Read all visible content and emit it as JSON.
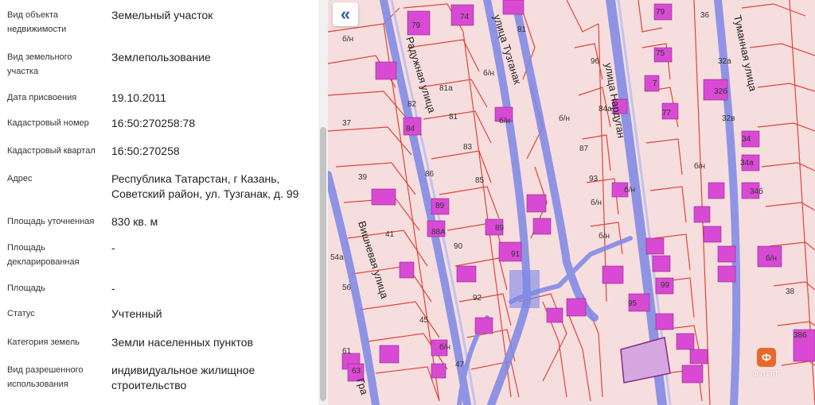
{
  "info_panel": {
    "rows": [
      {
        "label": "Вид объекта недвижимости",
        "value": "Земельный участок"
      },
      {
        "label": "Вид земельного участка",
        "value": "Землепользование"
      },
      {
        "label": "Дата присвоения",
        "value": "19.10.2011"
      },
      {
        "label": "Кадастровый номер",
        "value": "16:50:270258:78"
      },
      {
        "label": "Кадастровый квартал",
        "value": "16:50:270258"
      },
      {
        "label": "Адрес",
        "value": "Республика Татарстан, г Казань, Советский район, ул. Тузганак, д. 99"
      },
      {
        "label": "Площадь уточненная",
        "value": "830 кв. м"
      },
      {
        "label": "Площадь декларированная",
        "value": "-"
      },
      {
        "label": "Площадь",
        "value": "-"
      },
      {
        "label": "Статус",
        "value": "Учтенный"
      },
      {
        "label": "Категория земель",
        "value": "Земли населенных пунктов"
      },
      {
        "label": "Вид разрешенного использования",
        "value": "индивидуальное жилищное строительство"
      }
    ]
  },
  "map": {
    "collapse_icon": "double-chevron-left-icon",
    "collapse_symbol": "«",
    "streets": {
      "raduzhnaya": "Радужная улица",
      "tuzganak": "улица Тузганак",
      "narduglan": "улица Нардуган",
      "tumannaya": "Туманная улица",
      "vishnevaya": "Вишневая улица",
      "gra": "Гра"
    },
    "house_numbers": {
      "h74": "74",
      "h81": "81",
      "h79": "79",
      "h83": "83",
      "h86": "86",
      "h85": "85",
      "h82": "82",
      "h84": "84",
      "h81a": "81a",
      "h37": "37",
      "h39": "39",
      "h41": "41",
      "h90": "90",
      "h92": "92",
      "h45": "45",
      "h47": "47",
      "h56": "56",
      "h54a": "54a",
      "h63": "63",
      "h61": "61",
      "h89": "89",
      "h91": "91",
      "h87": "87",
      "h93": "93",
      "h95": "95",
      "h99": "99",
      "h32a": "32a",
      "h32b": "32б",
      "h34": "34",
      "h34a": "34a",
      "h34b": "34б",
      "h38": "38",
      "h386": "386",
      "h32v": "32в",
      "h36": "36",
      "h75": "75",
      "h77": "77",
      "h79b": "79",
      "h81b": "81",
      "h84a": "84a",
      "h88a": "88A",
      "h96": "96",
      "h7": "7",
      "bn1": "б/н",
      "bn2": "б/н",
      "bn3": "б/н",
      "bn4": "б/н",
      "bn5": "б/н",
      "bn6": "б/н",
      "bn7": "б/н",
      "bn8": "б/н",
      "bn9": "б/н",
      "bn10": "б/н"
    },
    "colors": {
      "parcel_fill": "#f7dede",
      "parcel_border": "#e0443a",
      "building": "#d84ad4",
      "road": "#7c87e6",
      "highlight": "#d6a6e0"
    }
  },
  "watermark": {
    "logo_char": "Ф",
    "text": "ФЛЭТ"
  }
}
